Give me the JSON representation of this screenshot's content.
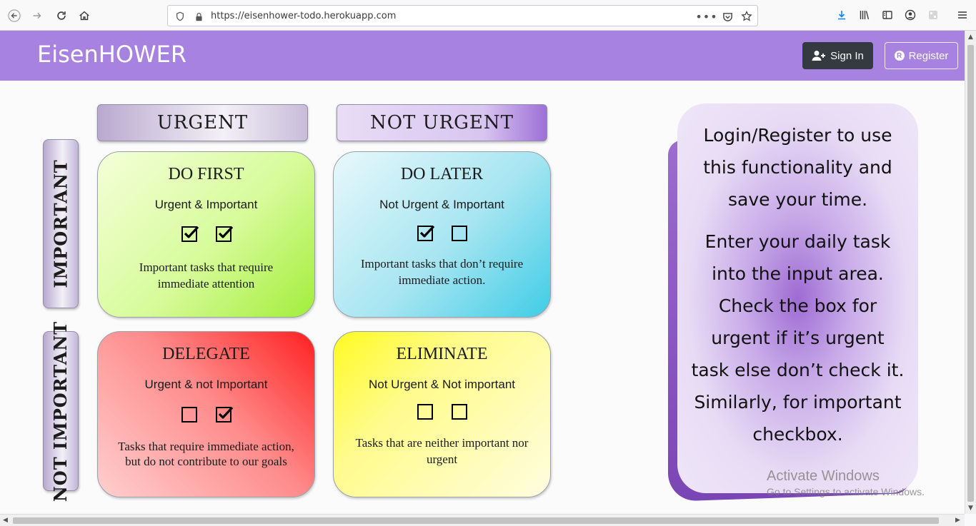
{
  "browser": {
    "url": "https://eisenhower-todo.herokuapp.com"
  },
  "header": {
    "brand": "EisenHOWER",
    "signin_label": "Sign In",
    "register_label": "Register"
  },
  "axes": {
    "urgent": "URGENT",
    "not_urgent": "NOT URGENT",
    "important": "IMPORTANT",
    "not_important": "NOT IMPORTANT"
  },
  "quadrants": {
    "do_first": {
      "title": "DO FIRST",
      "subtitle": "Urgent & Important",
      "urgent_checked": true,
      "important_checked": true,
      "description": "Important tasks that require immediate attention"
    },
    "do_later": {
      "title": "DO LATER",
      "subtitle": "Not Urgent & Important",
      "urgent_checked": true,
      "important_checked": false,
      "description": "Important tasks that don’t require immediate action."
    },
    "delegate": {
      "title": "DELEGATE",
      "subtitle": "Urgent & not Important",
      "urgent_checked": false,
      "important_checked": true,
      "description": "Tasks that require immediate action, but do not contribute to our goals"
    },
    "eliminate": {
      "title": "ELIMINATE",
      "subtitle": "Not Urgent & Not important",
      "urgent_checked": false,
      "important_checked": false,
      "description": "Tasks that are neither important nor urgent"
    }
  },
  "info": {
    "para1": "Login/Register to use this functionality and save your time.",
    "para2": "Enter your daily task into the input area. Check the box for urgent if it’s urgent task else don’t check it. Similarly, for important checkbox."
  },
  "watermark": {
    "line1": "Activate Windows",
    "line2": "Go to Settings to activate Windows."
  },
  "colors": {
    "header": "#a882e0",
    "signin_bg": "#343a40"
  }
}
